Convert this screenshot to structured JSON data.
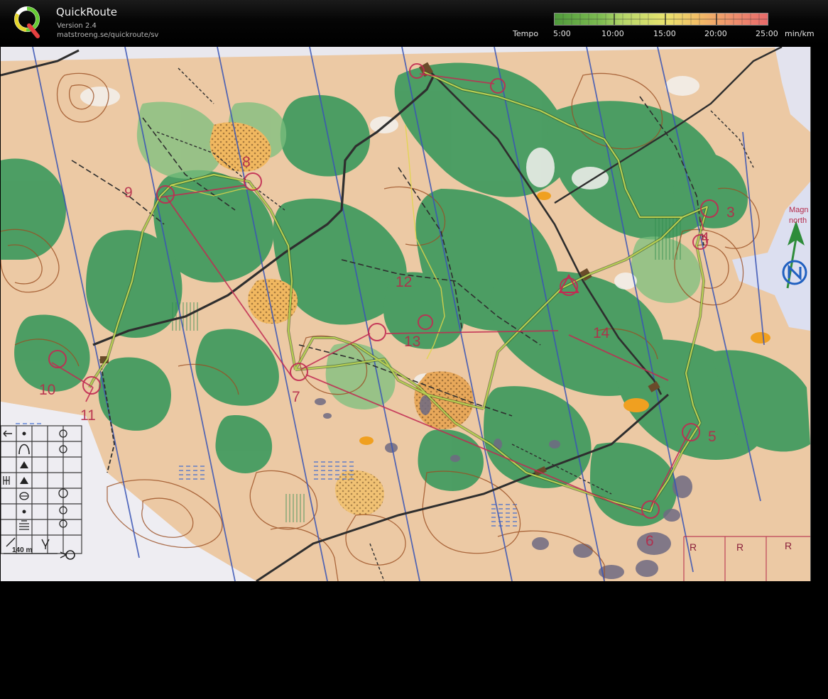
{
  "app": {
    "title": "QuickRoute",
    "version": "Version 2.4",
    "url": "matstroeng.se/quickroute/sv"
  },
  "legend": {
    "label": "Tempo",
    "ticks": [
      "5:00",
      "10:00",
      "15:00",
      "20:00",
      "25:00"
    ],
    "unit": "min/km",
    "colors": [
      "#4f9a3b",
      "#7fbd52",
      "#b6d66a",
      "#e9e36e",
      "#f2bb66",
      "#ee8f6d",
      "#e86a6a"
    ]
  },
  "map": {
    "controls": [
      "8",
      "9",
      "12",
      "13",
      "14",
      "3",
      "4",
      "5",
      "6",
      "7",
      "10",
      "11"
    ],
    "north_text": [
      "Magn",
      "north"
    ],
    "symbol_table": {
      "scale": "140 m"
    },
    "grid_letters": [
      "R",
      "R",
      "R"
    ],
    "colors": {
      "open_land": "#ecc9a4",
      "forest": "#3f9a5e",
      "contour": "#9a4e22",
      "track": "#2e2e2e",
      "route": "#b6ce53",
      "course": "#c12a52",
      "north_line": "#3a55b5",
      "water": "#d6dcf0"
    }
  }
}
